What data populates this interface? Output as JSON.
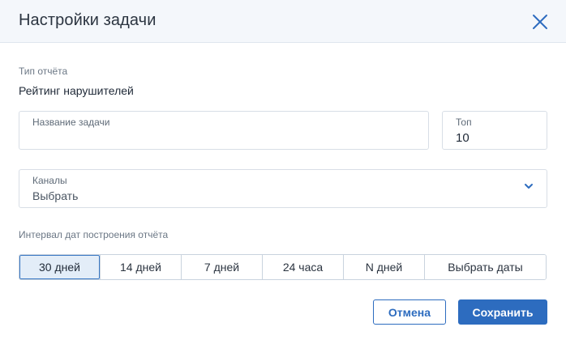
{
  "dialog": {
    "title": "Настройки задачи",
    "close_icon": "close-icon"
  },
  "report_type": {
    "label": "Тип отчёта",
    "value": "Рейтинг нарушителей"
  },
  "task_name": {
    "label": "Название задачи",
    "value": ""
  },
  "top": {
    "label": "Топ",
    "value": "10"
  },
  "channels": {
    "label": "Каналы",
    "value": "Выбрать",
    "icon": "chevron-down-icon"
  },
  "interval": {
    "label": "Интервал дат построения отчёта",
    "options": [
      "30 дней",
      "14 дней",
      "7 дней",
      "24 часа",
      "N дней",
      "Выбрать даты"
    ],
    "selected": "30 дней"
  },
  "actions": {
    "cancel_label": "Отмена",
    "save_label": "Сохранить"
  },
  "colors": {
    "accent": "#2d6cbf",
    "header_bg": "#f4f7fb",
    "selected_bg": "#e3edf8"
  }
}
